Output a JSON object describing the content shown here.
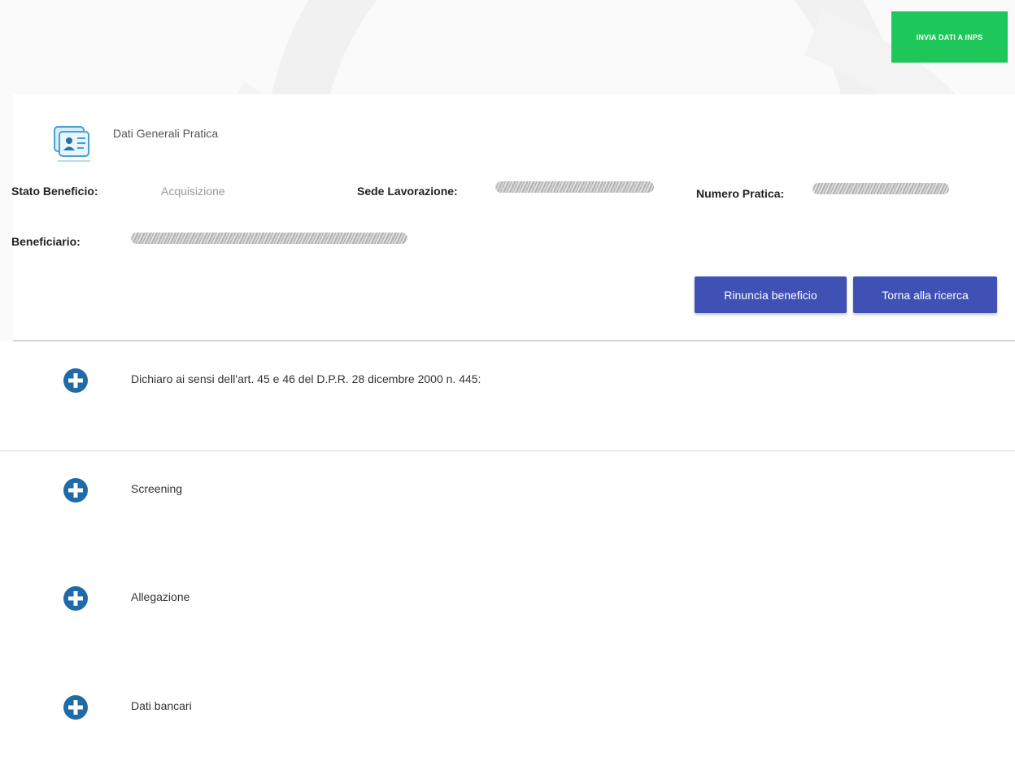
{
  "header": {
    "send_button_label": "INVIA DATI A INPS"
  },
  "general": {
    "title": "Dati Generali Pratica",
    "icon": "practice-card-icon",
    "stato_label": "Stato Beneficio:",
    "stato_value": "Acquisizione",
    "sede_label": "Sede Lavorazione:",
    "numero_label": "Numero Pratica:",
    "beneficiario_label": "Beneficiario:",
    "rinuncia_button": "Rinuncia beneficio",
    "torna_button": "Torna alla ricerca"
  },
  "sections": [
    {
      "title": "Dichiaro ai sensi dell'art. 45 e 46 del D.P.R. 28 dicembre 2000 n. 445:",
      "icon": "plus-circle-icon"
    },
    {
      "title": "Screening",
      "icon": "plus-circle-icon"
    },
    {
      "title": "Allegazione",
      "icon": "plus-circle-icon"
    },
    {
      "title": "Dati bancari",
      "icon": "plus-circle-icon"
    }
  ],
  "colors": {
    "send_button": "#1ec75a",
    "primary_button": "#3f51b5",
    "expand_icon": "#1f6aa8"
  }
}
